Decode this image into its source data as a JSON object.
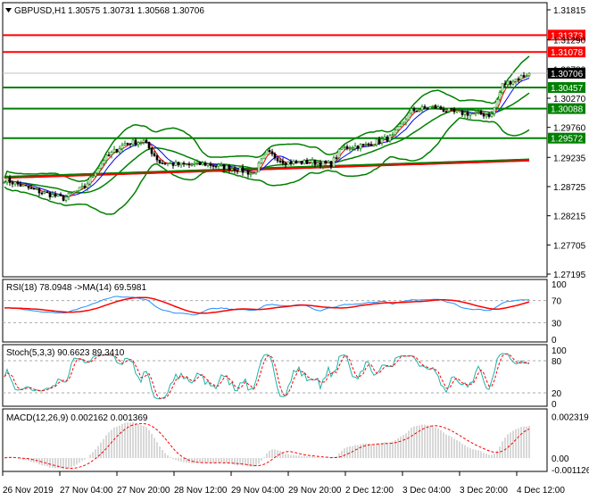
{
  "header": {
    "symbol_label": "GBPUSD,H1",
    "ohlc": "1.30575 1.30731 1.30568 1.30706"
  },
  "price_axis": {
    "ticks": [
      "1.31815",
      "1.31290",
      "1.30780",
      "1.30270",
      "1.29760",
      "1.29235",
      "1.28725",
      "1.28215",
      "1.27705",
      "1.27195"
    ],
    "tick_values": [
      1.31815,
      1.3129,
      1.3078,
      1.3027,
      1.2976,
      1.29235,
      1.28725,
      1.28215,
      1.27705,
      1.27195
    ],
    "range": [
      1.27195,
      1.31815
    ]
  },
  "levels": [
    {
      "label": "1.31373",
      "value": 1.31373,
      "color": "#ff0000"
    },
    {
      "label": "1.31078",
      "value": 1.31078,
      "color": "#ff0000"
    },
    {
      "label": "1.30457",
      "value": 1.30457,
      "color": "#008000"
    },
    {
      "label": "1.30088",
      "value": 1.30088,
      "color": "#008000"
    },
    {
      "label": "1.29572",
      "value": 1.29572,
      "color": "#008000"
    }
  ],
  "current_price": {
    "label": "1.30706",
    "value": 1.30706
  },
  "price_path": [
    [
      0,
      1.2885
    ],
    [
      10,
      1.2868
    ],
    [
      22,
      1.2852
    ],
    [
      30,
      1.2872
    ],
    [
      37,
      1.292
    ],
    [
      45,
      1.2948
    ],
    [
      52,
      1.2952
    ],
    [
      58,
      1.2915
    ],
    [
      66,
      1.291
    ],
    [
      75,
      1.2912
    ],
    [
      85,
      1.2905
    ],
    [
      93,
      1.2895
    ],
    [
      98,
      1.2932
    ],
    [
      105,
      1.2915
    ],
    [
      115,
      1.2915
    ],
    [
      122,
      1.2912
    ],
    [
      126,
      1.294
    ],
    [
      135,
      1.2945
    ],
    [
      145,
      1.296
    ],
    [
      152,
      1.3005
    ],
    [
      160,
      1.3012
    ],
    [
      168,
      1.3002
    ],
    [
      175,
      1.3
    ],
    [
      182,
      1.2998
    ],
    [
      186,
      1.305
    ],
    [
      196,
      1.3071
    ]
  ],
  "rsi": {
    "label": "RSI(18) 78.0948  ->MA(14) 69.5981",
    "ticks": [
      "100",
      "70",
      "30",
      "0"
    ],
    "levels": [
      70,
      30
    ]
  },
  "stoch": {
    "label": "Stoch(5,3,3) 90.6623 89.3410",
    "ticks": [
      "100",
      "80",
      "20",
      "0"
    ],
    "levels": [
      80,
      20
    ]
  },
  "macd": {
    "label": "MACD(12,26,9) 0.002162 0.001369",
    "ticks": [
      "0.002319",
      "0.00",
      "-0.001126"
    ]
  },
  "time_axis": [
    "26 Nov 2019",
    "27 Nov 04:00",
    "27 Nov 20:00",
    "28 Nov 12:00",
    "29 Nov 04:00",
    "29 Nov 20:00",
    "2 Dec 12:00",
    "3 Dec 04:00",
    "3 Dec 20:00",
    "4 Dec 12:00"
  ],
  "colors": {
    "bull": "#008000",
    "bear": "#000000",
    "ma_red": "#ff0000",
    "ma_blue": "#0000ff",
    "band": "#008000",
    "rsi": "#1e90ff",
    "stoch": "#20b2aa"
  }
}
